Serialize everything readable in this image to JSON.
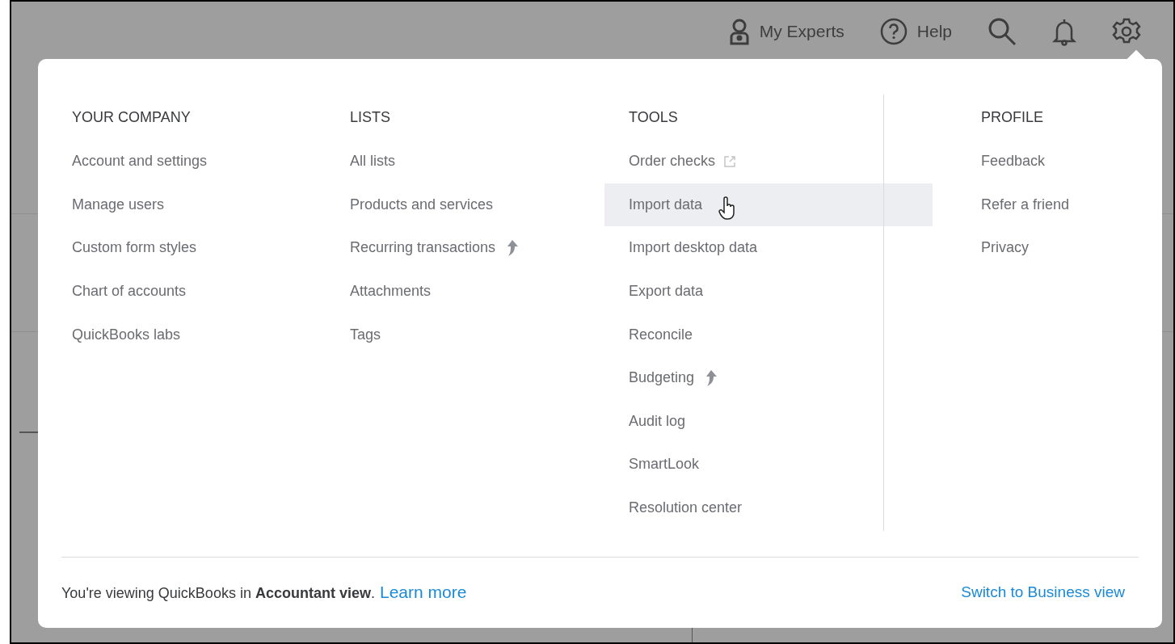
{
  "top_bar": [
    {
      "kind": "experts",
      "label": "My Experts"
    },
    {
      "kind": "help",
      "label": "Help"
    },
    {
      "kind": "search"
    },
    {
      "kind": "notifications"
    },
    {
      "kind": "settings"
    }
  ],
  "columns": [
    {
      "heading": "YOUR COMPANY",
      "items": [
        {
          "label": "Account and settings",
          "hovered": false
        },
        {
          "label": "Manage users",
          "hovered": false
        },
        {
          "label": "Custom form styles",
          "hovered": false
        },
        {
          "label": "Chart of accounts",
          "hovered": false
        },
        {
          "label": "QuickBooks labs",
          "hovered": false
        }
      ]
    },
    {
      "heading": "LISTS",
      "items": [
        {
          "label": "All lists",
          "hovered": false
        },
        {
          "label": "Products and services",
          "hovered": false
        },
        {
          "label": "Recurring transactions",
          "kind": "upgrade",
          "hovered": false
        },
        {
          "label": "Attachments",
          "hovered": false
        },
        {
          "label": "Tags",
          "hovered": false
        }
      ]
    },
    {
      "heading": "TOOLS",
      "items": [
        {
          "label": "Order checks",
          "kind": "external",
          "hovered": false
        },
        {
          "label": "Import data",
          "hovered": true
        },
        {
          "label": "Import desktop data",
          "hovered": false
        },
        {
          "label": "Export data",
          "hovered": false
        },
        {
          "label": "Reconcile",
          "hovered": false
        },
        {
          "label": "Budgeting",
          "kind": "upgrade",
          "hovered": false
        },
        {
          "label": "Audit log",
          "hovered": false
        },
        {
          "label": "SmartLook",
          "hovered": false
        },
        {
          "label": "Resolution center",
          "hovered": false
        }
      ]
    },
    {
      "heading": "PROFILE",
      "items": [
        {
          "label": "Feedback",
          "hovered": false
        },
        {
          "label": "Refer a friend",
          "hovered": false
        },
        {
          "label": "Privacy",
          "hovered": false
        }
      ]
    }
  ],
  "footer": {
    "message": "You're viewing QuickBooks in **Accountant view**.",
    "link": "Learn more",
    "switch_link": "Switch to Business view"
  }
}
